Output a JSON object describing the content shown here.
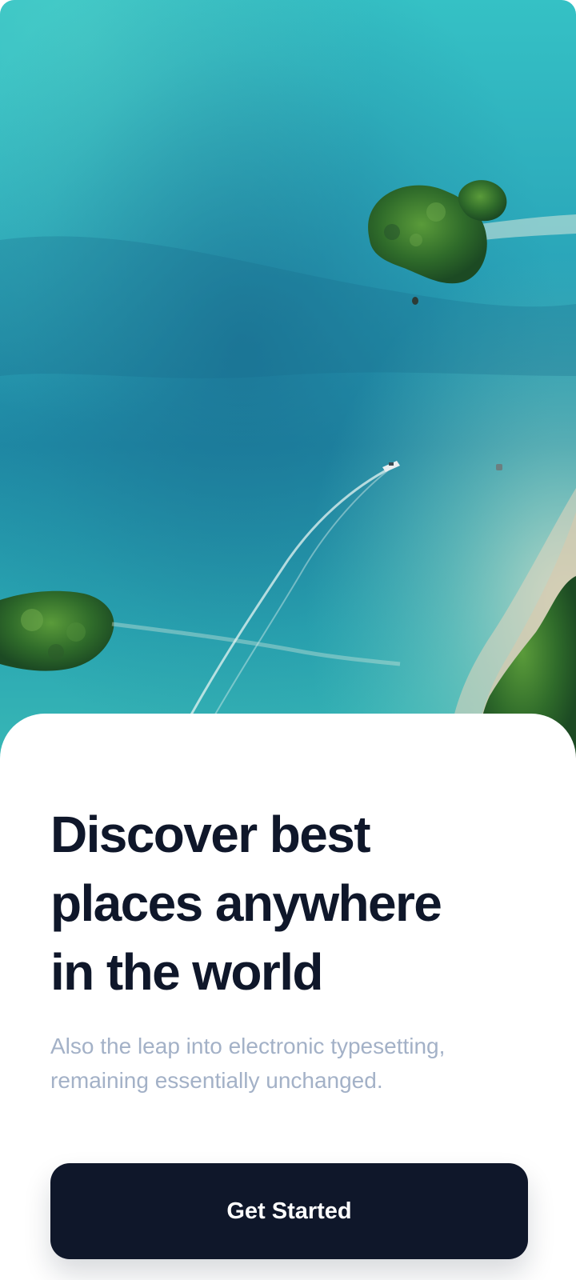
{
  "onboarding": {
    "headline_lines": [
      "Discover best",
      "places anywhere",
      "in the world"
    ],
    "subtitle_lines": [
      "Also the leap into electronic typesetting,",
      "remaining essentially unchanged."
    ],
    "cta_label": "Get Started"
  },
  "colors": {
    "headline": "#0f172a",
    "subtitle": "#a3b1c7",
    "button_background": "#0f172a",
    "button_text": "#ffffff",
    "sea_light": "#31b9c0",
    "sea_deep": "#1b7f99"
  },
  "hero_image": {
    "subject": "aerial-sea-islands-photo"
  }
}
